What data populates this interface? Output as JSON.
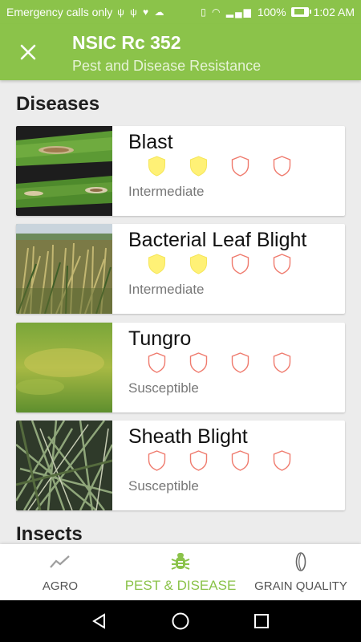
{
  "status_bar": {
    "carrier_text": "Emergency calls only",
    "battery": "100%",
    "time": "1:02 AM"
  },
  "app_bar": {
    "title": "NSIC Rc 352",
    "subtitle": "Pest and Disease Resistance"
  },
  "sections": {
    "diseases": {
      "title": "Diseases",
      "items": [
        {
          "name": "Blast",
          "level": "Intermediate",
          "rating": 2,
          "max_rating": 4
        },
        {
          "name": "Bacterial Leaf Blight",
          "level": "Intermediate",
          "rating": 2,
          "max_rating": 4
        },
        {
          "name": "Tungro",
          "level": "Susceptible",
          "rating": 0,
          "max_rating": 4
        },
        {
          "name": "Sheath Blight",
          "level": "Susceptible",
          "rating": 0,
          "max_rating": 4
        }
      ]
    },
    "insects": {
      "title": "Insects"
    }
  },
  "bottom_nav": [
    {
      "label": "AGRO",
      "icon": "trend-line-icon",
      "active": false
    },
    {
      "label": "PEST & DISEASE",
      "icon": "bug-icon",
      "active": true
    },
    {
      "label": "GRAIN QUALITY",
      "icon": "grain-icon",
      "active": false
    }
  ],
  "colors": {
    "primary": "#8bc34a",
    "shield_filled": "#fff176",
    "shield_outline": "#ef7b6e"
  }
}
